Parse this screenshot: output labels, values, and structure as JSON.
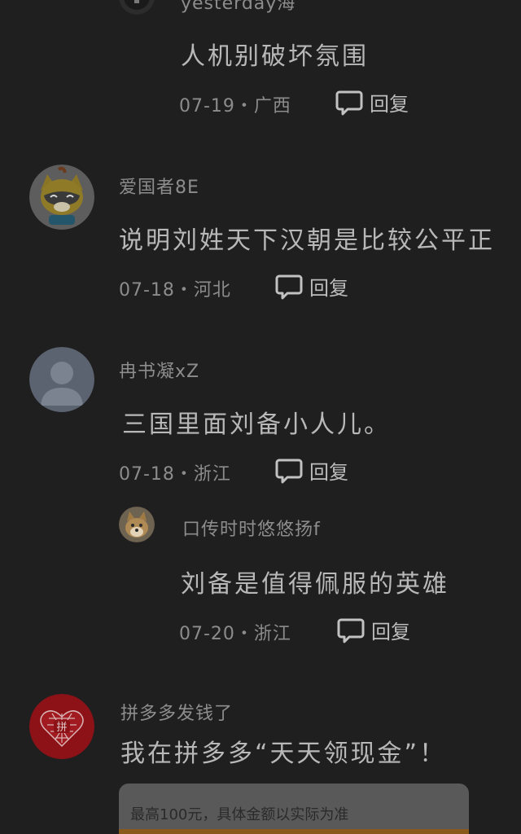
{
  "comments": [
    {
      "name": "yesterday海",
      "content": "人机别破坏氛围",
      "meta": "07-19・广西",
      "reply_label": "回复"
    },
    {
      "name": "爱国者8E",
      "content": "说明刘姓天下汉朝是比较公平正",
      "meta": "07-18・河北",
      "reply_label": "回复"
    },
    {
      "name": "冉书凝xZ",
      "content": "三国里面刘备小人儿。",
      "meta": "07-18・浙江",
      "reply_label": "回复"
    },
    {
      "name": "口传时时悠悠扬f",
      "content": "刘备是值得佩服的英雄",
      "meta": "07-20・浙江",
      "reply_label": "回复"
    }
  ],
  "ad": {
    "name": "拼多多发钱了",
    "content": "我在拼多多“天天领现金”！",
    "card_text": "最高100元，具体金额以实际为准",
    "logo_text": "拼"
  },
  "icons": {
    "reply": "comment-bubble-icon"
  },
  "colors": {
    "background": "#1f1f1f",
    "brand_red": "#b2141c",
    "accent_orange": "#8a5a1d"
  }
}
